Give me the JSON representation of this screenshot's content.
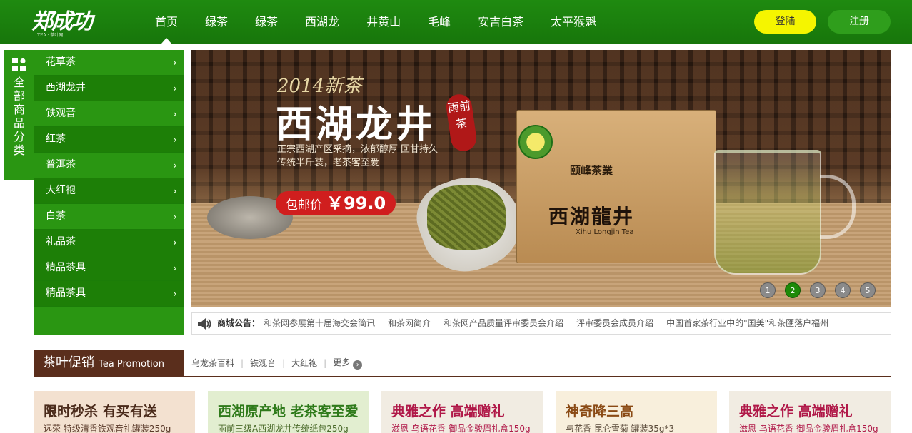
{
  "header": {
    "logo_text": "郑成功",
    "logo_sub": "TEA · 茶叶网",
    "nav": [
      "首页",
      "绿茶",
      "绿茶",
      "西湖龙",
      "井黄山",
      "毛峰",
      "安吉白茶",
      "太平猴魁"
    ],
    "active_nav": 0,
    "login_label": "登陆",
    "register_label": "注册",
    "colors": {
      "bar": "#1f8a10",
      "login_bg": "#f5f500",
      "register_bg": "#2f9e1c"
    }
  },
  "sidebar": {
    "all_label": "全部商品分类",
    "icon": "grid-icon",
    "categories": [
      {
        "label": "花草茶",
        "icon": "chevron-right-icon"
      },
      {
        "label": "西湖龙井",
        "icon": "chevron-right-icon"
      },
      {
        "label": "铁观音",
        "icon": "chevron-right-icon"
      },
      {
        "label": "红茶",
        "icon": "chevron-right-icon"
      },
      {
        "label": "普洱茶",
        "icon": "chevron-right-icon"
      },
      {
        "label": "大红袍",
        "icon": "chevron-right-icon"
      },
      {
        "label": "白茶",
        "icon": "chevron-right-icon"
      },
      {
        "label": "礼品茶",
        "icon": "chevron-right-icon"
      },
      {
        "label": "精品茶具",
        "icon": "chevron-right-icon"
      },
      {
        "label": "精品茶具",
        "icon": "chevron-right-icon"
      }
    ]
  },
  "banner": {
    "year": "2014新茶",
    "headline": "西湖龙井",
    "seal": "雨前茶",
    "desc_line1": "正宗西湖产区采摘，浓郁醇厚 回甘持久",
    "desc_line2": "传统半斤装，老茶客至爱",
    "price_label": "包邮价",
    "price_value": "￥99.0",
    "package_brand": "颐峰茶業",
    "package_name": "西湖龍井",
    "package_en": "Xihu Longjin Tea",
    "slides": [
      "1",
      "2",
      "3",
      "4",
      "5"
    ],
    "active_slide": 1
  },
  "notice": {
    "icon": "speaker-icon",
    "label": "商城公告：",
    "links": [
      "和茶网参展第十届海交会简讯",
      "和茶网简介",
      "和茶网产品质量评审委员会介绍",
      "评审委员会成员介绍",
      "中国首家茶行业中的\"国美\"和茶匯落户福州"
    ]
  },
  "promo": {
    "title_cn": "茶叶促销",
    "title_en": "Tea Promotion",
    "tags": [
      "乌龙茶百科",
      "铁观音",
      "大红袍"
    ],
    "more_label": "更多",
    "more_icon": "chevron-right-circle-icon",
    "accent": "#5a2e1c"
  },
  "cards": [
    {
      "title": "限时秒杀 有买有送",
      "sub": "远荣 特级清香铁观音礼罐装250g",
      "bg": "#f3e1d0",
      "title_color": "#4a2a1a",
      "sub_color": "#5a3a2a"
    },
    {
      "title": "西湖原产地 老茶客至爱",
      "sub": "雨前三级A西湖龙井传统纸包250g",
      "bg": "#e2eed0",
      "title_color": "#2e7a1a",
      "sub_color": "#4a6a2a"
    },
    {
      "title": "典雅之作 高端赠礼",
      "sub": "滋恩 鸟语花香-御品金骏眉礼盒150g",
      "bg": "#f1ece2",
      "title_color": "#b01848",
      "sub_color": "#b01848"
    },
    {
      "title": "神奇降三高",
      "sub": "与花香 昆仑雪菊 罐装35g*3",
      "bg": "#f8efdc",
      "title_color": "#8a4a14",
      "sub_color": "#5a4a3a"
    },
    {
      "title": "典雅之作 高端赠礼",
      "sub": "滋恩 鸟语花香-御品金骏眉礼盒150g",
      "bg": "#f1ece2",
      "title_color": "#b01848",
      "sub_color": "#b01848"
    }
  ]
}
